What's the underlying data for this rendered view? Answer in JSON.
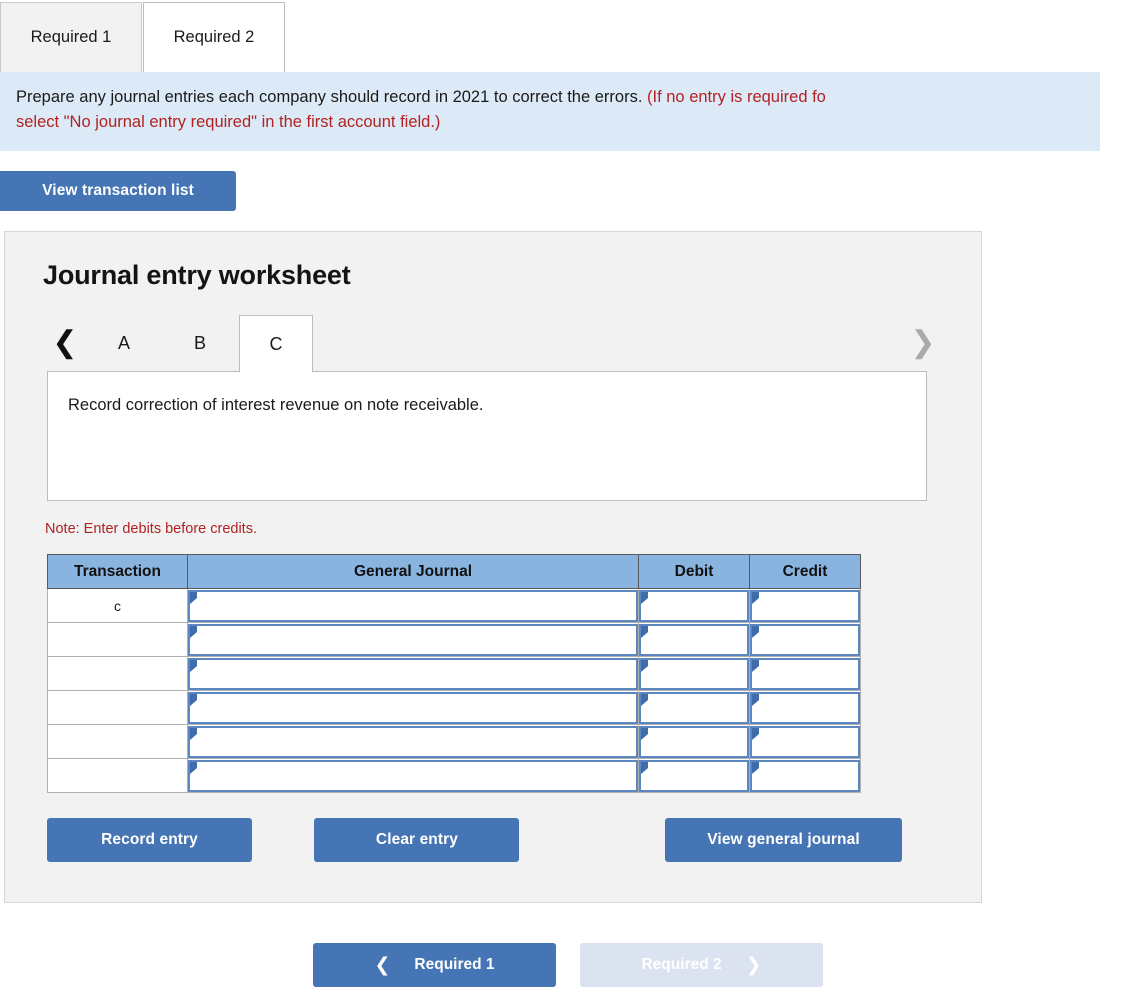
{
  "top_tabs": [
    {
      "label": "Required 1",
      "active": false
    },
    {
      "label": "Required 2",
      "active": true
    }
  ],
  "banner": {
    "line1_black": "Prepare any journal entries each company should record in 2021 to correct the errors.",
    "line1_red": " (If no entry is required fo",
    "line2_red": "select \"No journal entry required\" in the first account field.)"
  },
  "toolbar": {
    "view_transaction_list": "View transaction list"
  },
  "worksheet": {
    "title": "Journal entry worksheet",
    "prev_icon": "chevron-left-icon",
    "next_icon": "chevron-right-icon",
    "sheet_tabs": [
      {
        "label": "A",
        "active": false
      },
      {
        "label": "B",
        "active": false
      },
      {
        "label": "C",
        "active": true
      }
    ],
    "description": "Record correction of interest revenue on note receivable.",
    "note": "Note: Enter debits before credits.",
    "table": {
      "headers": [
        "Transaction",
        "General Journal",
        "Debit",
        "Credit"
      ],
      "rows": [
        {
          "transaction": "c",
          "general_journal": "",
          "debit": "",
          "credit": ""
        },
        {
          "transaction": "",
          "general_journal": "",
          "debit": "",
          "credit": ""
        },
        {
          "transaction": "",
          "general_journal": "",
          "debit": "",
          "credit": ""
        },
        {
          "transaction": "",
          "general_journal": "",
          "debit": "",
          "credit": ""
        },
        {
          "transaction": "",
          "general_journal": "",
          "debit": "",
          "credit": ""
        },
        {
          "transaction": "",
          "general_journal": "",
          "debit": "",
          "credit": ""
        }
      ]
    },
    "actions": {
      "record_entry": "Record entry",
      "clear_entry": "Clear entry",
      "view_general_journal": "View general journal"
    }
  },
  "bottom_nav": {
    "prev_icon": "chevron-left-icon",
    "prev_label": "Required 1",
    "next_label": "Required 2",
    "next_icon": "chevron-right-icon"
  },
  "colors": {
    "accent_blue": "#4575b5",
    "header_blue": "#8ab4e0",
    "banner_blue": "#dceaf7",
    "panel_gray": "#f2f2f2",
    "red_text": "#b22222",
    "disabled_blue": "#dae3ef"
  }
}
